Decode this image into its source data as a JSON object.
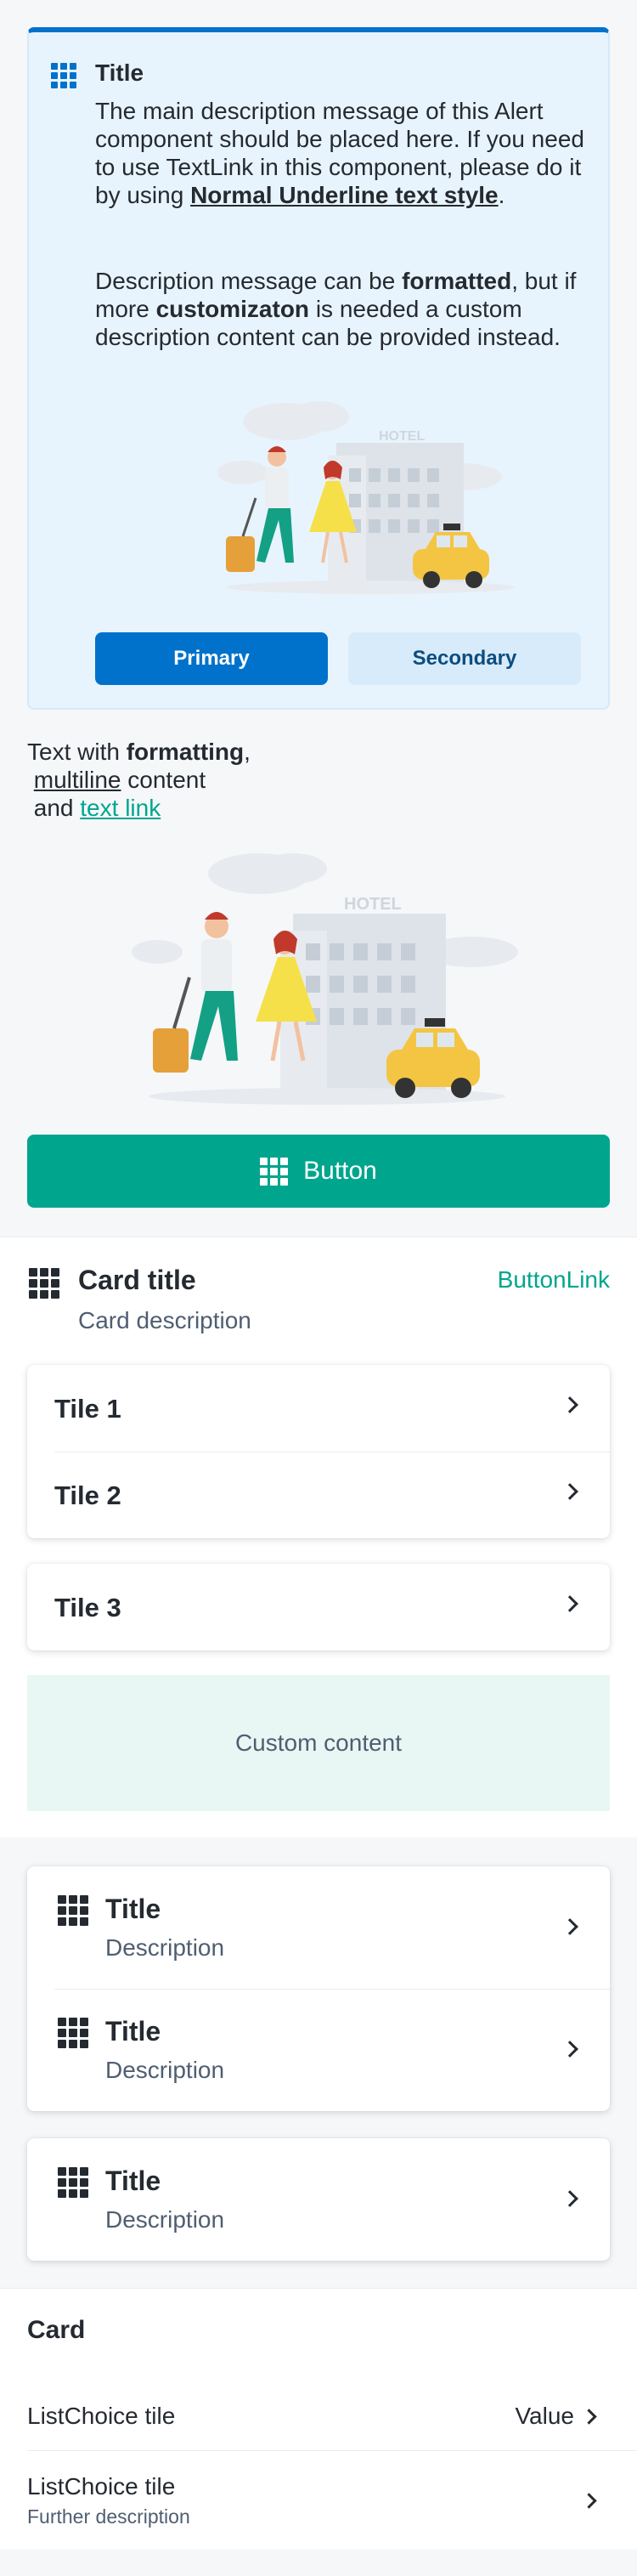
{
  "alert": {
    "title": "Title",
    "p1": {
      "text": "The main description message of this Alert component should be placed here. If you need to use TextLink in this component, please do it by using ",
      "link": "Normal Underline text style",
      "end": "."
    },
    "p2": {
      "t1": "Description message can be ",
      "b1": "formatted",
      "t2": ", but if more ",
      "b2": "customizaton",
      "t3": " is needed a custom description content can be provided instead."
    },
    "illustration_sign": "HOTEL",
    "primary_label": "Primary",
    "secondary_label": "Secondary"
  },
  "formatted_text": {
    "t1": "Text with ",
    "b1": "formatting",
    "t2": ",",
    "u1": "multiline",
    "t3": " content",
    "t4": "and ",
    "link": "text link"
  },
  "illustration_sign": "HOTEL",
  "main_button_label": "Button",
  "card": {
    "title": "Card title",
    "description": "Card description",
    "button_link": "ButtonLink",
    "tiles_group": [
      "Tile 1",
      "Tile 2"
    ],
    "tile_single": "Tile 3",
    "custom_content": "Custom content"
  },
  "title_tiles": {
    "group": [
      {
        "title": "Title",
        "description": "Description"
      },
      {
        "title": "Title",
        "description": "Description"
      }
    ],
    "single": {
      "title": "Title",
      "description": "Description"
    }
  },
  "list_choice_card": {
    "title": "Card",
    "row1": {
      "label": "ListChoice tile",
      "value": "Value"
    },
    "row2": {
      "label": "ListChoice tile",
      "description": "Further description"
    }
  },
  "colors": {
    "blue": "#0172cb",
    "green": "#00a58e",
    "ink": "#252a31"
  }
}
